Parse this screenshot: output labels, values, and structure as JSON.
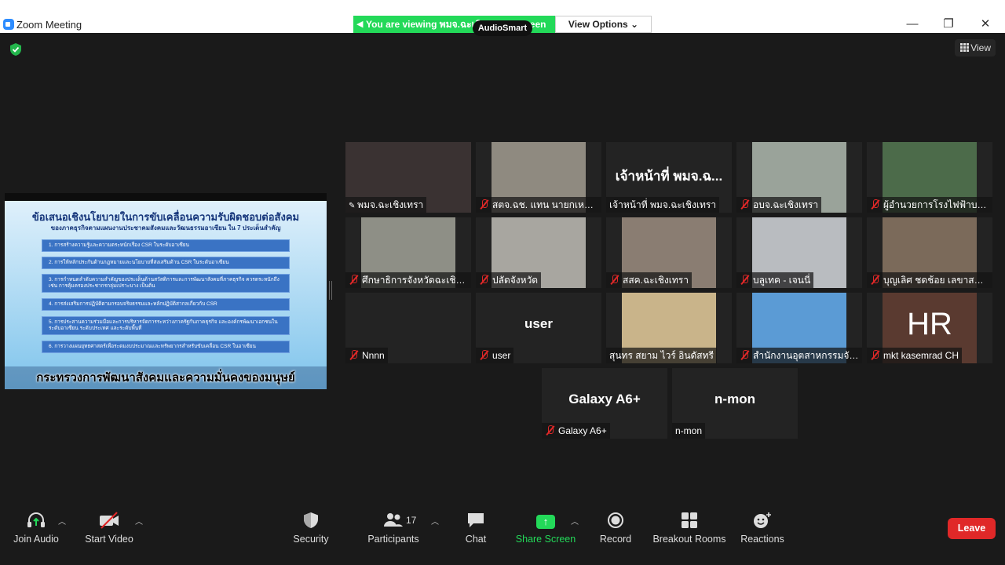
{
  "window": {
    "title": "Zoom Meeting"
  },
  "banner": {
    "viewing_text": "You are viewing พมจ.ฉะเชิงเทรา's screen",
    "view_options": "View Options ⌄",
    "overlay": "AudioSmart"
  },
  "view_button": {
    "label": "View"
  },
  "shared_slide": {
    "title": "ข้อเสนอเชิงนโยบายในการขับเคลื่อนความรับผิดชอบต่อสังคม",
    "subtitle": "ของภาคธุรกิจตามแผนงานประชาคมสังคมและวัฒนธรรมอาเซียน ใน 7 ประเด็นสำคัญ",
    "items": [
      "1. การสร้างความรู้และความตระหนักเรื่อง CSR ในระดับอาเซียน",
      "2. การให้หลักประกันด้านกฎหมายและนโยบายที่ส่งเสริมด้าน CSR ในระดับอาเซียน",
      "3. การกำหนดลำดับความสำคัญของประเด็นด้านสวัสดิการและการพัฒนาสังคมที่ภาคธุรกิจ ควรตระหนักถึง เช่น การคุ้มครองประชากรกลุ่มเปราะบาง เป็นต้น",
      "4. การส่งเสริมการปฏิบัติตามกรอบจริยธรรมและหลักปฏิบัติสากลเกี่ยวกับ CSR",
      "5. การประสานความร่วมมือและการบริหารจัดการระหว่างภาครัฐกับภาคธุรกิจ และองค์กรพัฒนาเอกชนในระดับอาเซียน ระดับประเทศ และระดับพื้นที่",
      "6. การวางแผนยุทธศาสตร์เพื่อระดมงบประมาณและทรัพยากรสำหรับขับเคลื่อน CSR ในอาเซียน"
    ],
    "footer": "กระทรวงการพัฒนาสังคมและความมั่นคงของมนุษย์"
  },
  "participants": [
    {
      "name": "พมจ.ฉะเชิงเทรา",
      "big": "",
      "muted": false,
      "pinned": true,
      "active": true,
      "bg": "#3a3232"
    },
    {
      "name": "สตจ.ฉช. แทน นายกเหล่ากาชาด",
      "big": "",
      "muted": true,
      "pinned": false,
      "active": false,
      "bg": "#8f8a80"
    },
    {
      "name": "เจ้าหน้าที่ พมจ.ฉะเชิงเทรา",
      "big": "เจ้าหน้าที่ พมจ.ฉ...",
      "muted": false,
      "pinned": false,
      "active": false,
      "bg": ""
    },
    {
      "name": "อบจ.ฉะเชิงเทรา",
      "big": "",
      "muted": true,
      "pinned": false,
      "active": false,
      "bg": "#9aa39a"
    },
    {
      "name": "ผู้อำนวยการโรงไฟฟ้าบางปะกง",
      "big": "",
      "muted": true,
      "pinned": false,
      "active": false,
      "bg": "#4c6b4a"
    },
    {
      "name": "ศึกษาธิการจังหวัดฉะเชิงเทรา",
      "big": "",
      "muted": true,
      "pinned": false,
      "active": false,
      "bg": "#8e8f86"
    },
    {
      "name": "ปลัดจังหวัด",
      "big": "",
      "muted": true,
      "pinned": false,
      "active": false,
      "bg": "#a8a6a0"
    },
    {
      "name": "สสค.ฉะเชิงเทรา",
      "big": "",
      "muted": true,
      "pinned": false,
      "active": false,
      "bg": "#8a7d72"
    },
    {
      "name": "บลูเทค - เจนนี่",
      "big": "",
      "muted": true,
      "pinned": false,
      "active": false,
      "bg": "#b9bcc0"
    },
    {
      "name": "บุญเลิศ ชดช้อย เลขาสภาองค์กรชุมชน",
      "big": "",
      "muted": true,
      "pinned": false,
      "active": false,
      "bg": "#7b6a5a"
    },
    {
      "name": "Nnnn",
      "big": "",
      "muted": true,
      "pinned": false,
      "active": false,
      "bg": ""
    },
    {
      "name": "user",
      "big": "user",
      "muted": true,
      "pinned": false,
      "active": false,
      "bg": ""
    },
    {
      "name": "สุนทร สยาม ไวร์ อินดัสทรี",
      "big": "",
      "muted": false,
      "pinned": false,
      "active": false,
      "bg": "#c9b48a"
    },
    {
      "name": "สำนักงานอุตสาหกรรมจังหวัด",
      "big": "",
      "muted": true,
      "pinned": false,
      "active": false,
      "bg": "#5b9bd5"
    },
    {
      "name": "mkt kasemrad CH",
      "big": "HR",
      "muted": true,
      "pinned": false,
      "active": false,
      "bg": "#5a3a30"
    },
    {
      "name": "Galaxy A6+",
      "big": "Galaxy A6+",
      "muted": true,
      "pinned": false,
      "active": false,
      "bg": ""
    },
    {
      "name": "n-mon",
      "big": "n-mon",
      "muted": false,
      "pinned": false,
      "active": false,
      "bg": ""
    }
  ],
  "toolbar": {
    "join_audio": "Join Audio",
    "start_video": "Start Video",
    "security": "Security",
    "participants": "Participants",
    "participants_count": "17",
    "chat": "Chat",
    "share_screen": "Share Screen",
    "record": "Record",
    "breakout_rooms": "Breakout Rooms",
    "reactions": "Reactions",
    "leave": "Leave"
  },
  "colors": {
    "accent": "#2d8cff",
    "share_green": "#23d959",
    "leave_red": "#e02828",
    "active_outline": "#e6e64c"
  }
}
